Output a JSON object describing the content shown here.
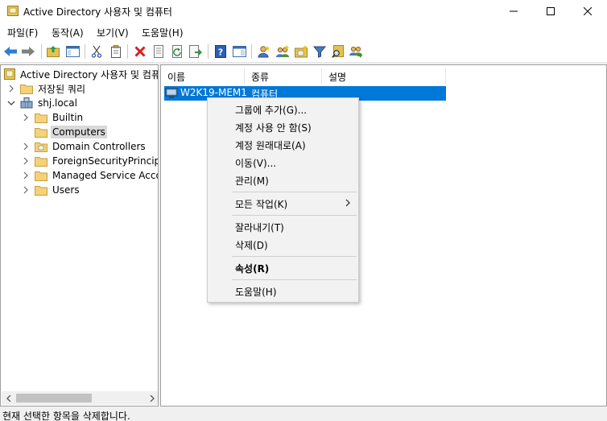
{
  "window": {
    "title": "Active Directory 사용자 및 컴퓨터"
  },
  "menubar": [
    "파일(F)",
    "동작(A)",
    "보기(V)",
    "도움말(H)"
  ],
  "toolbar": [
    "back-arrow-icon",
    "forward-arrow-icon",
    "up-folder-icon",
    "show-hide-tree-icon",
    "cut-icon",
    "copy-icon",
    "delete-icon",
    "properties-icon",
    "refresh-icon",
    "export-list-icon",
    "help-icon",
    "show-action-pane-icon",
    "new-user-icon",
    "new-group-icon",
    "new-ou-icon",
    "filter-icon",
    "find-icon",
    "add-to-group-icon"
  ],
  "tree": {
    "root": "Active Directory 사용자 및 컴퓨터",
    "saved_queries": "저장된 쿼리",
    "domain": "shj.local",
    "children": [
      "Builtin",
      "Computers",
      "Domain Controllers",
      "ForeignSecurityPrincipal",
      "Managed Service Accou",
      "Users"
    ],
    "selected": "Computers"
  },
  "list": {
    "columns": [
      "이름",
      "종류",
      "설명"
    ],
    "rows": [
      {
        "name": "W2K19-MEM1",
        "type": "컴퓨터",
        "desc": ""
      }
    ]
  },
  "context_menu": {
    "add_to_group": "그룹에 추가(G)...",
    "disable_account": "계정 사용 안 함(S)",
    "reset_account": "계정 원래대로(A)",
    "move": "이동(V)...",
    "manage": "관리(M)",
    "all_tasks": "모든 작업(K)",
    "cut": "잘라내기(T)",
    "delete": "삭제(D)",
    "properties": "속성(R)",
    "help": "도움말(H)"
  },
  "status": "현재 선택한 항목을 삭제합니다."
}
